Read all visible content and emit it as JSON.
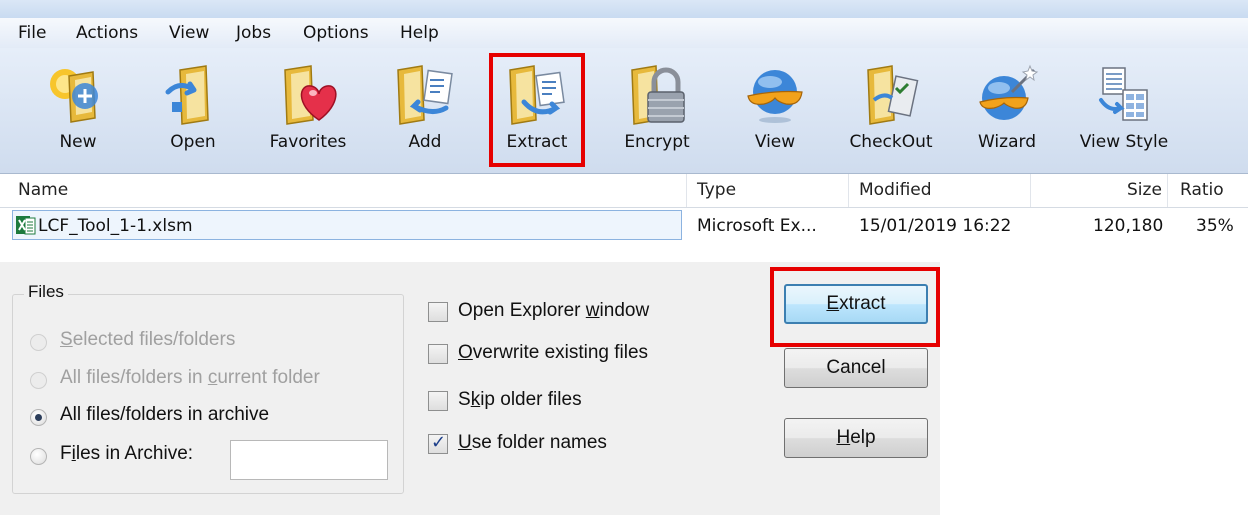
{
  "menu": [
    "File",
    "Actions",
    "View",
    "Jobs",
    "Options",
    "Help"
  ],
  "toolbar": [
    {
      "label": "New",
      "icon": "new-icon"
    },
    {
      "label": "Open",
      "icon": "open-icon"
    },
    {
      "label": "Favorites",
      "icon": "favorites-icon"
    },
    {
      "label": "Add",
      "icon": "add-icon"
    },
    {
      "label": "Extract",
      "icon": "extract-icon"
    },
    {
      "label": "Encrypt",
      "icon": "encrypt-icon"
    },
    {
      "label": "View",
      "icon": "view-icon"
    },
    {
      "label": "CheckOut",
      "icon": "checkout-icon"
    },
    {
      "label": "Wizard",
      "icon": "wizard-icon"
    },
    {
      "label": "View Style",
      "icon": "view-style-icon"
    }
  ],
  "columns": {
    "name": "Name",
    "type": "Type",
    "modified": "Modified",
    "size": "Size",
    "ratio": "Ratio"
  },
  "file": {
    "name": "LCF_Tool_1-1.xlsm",
    "type": "Microsoft Ex...",
    "modified": "15/01/2019 16:22",
    "size": "120,180",
    "ratio": "35%"
  },
  "dialog": {
    "files_group": "Files",
    "radio": [
      {
        "pre": "",
        "ul": "S",
        "post": "elected files/folders",
        "state": "disabled"
      },
      {
        "pre": "All files/folders in ",
        "ul": "c",
        "post": "urrent folder",
        "state": "disabled"
      },
      {
        "pre": "All files/folders in archive",
        "ul": "",
        "post": "",
        "state": "selected"
      },
      {
        "pre": "F",
        "ul": "i",
        "post": "les in Archive:",
        "state": "unselected"
      }
    ],
    "files_in_archive_value": "",
    "checkboxes": [
      {
        "pre": "Open Explorer ",
        "ul": "w",
        "post": "indow",
        "checked": false
      },
      {
        "pre": "",
        "ul": "O",
        "post": "verwrite existing files",
        "checked": false
      },
      {
        "pre": "S",
        "ul": "k",
        "post": "ip older files",
        "checked": false
      },
      {
        "pre": "",
        "ul": "U",
        "post": "se folder names",
        "checked": true
      }
    ],
    "buttons": {
      "extract": {
        "pre": "",
        "ul": "E",
        "post": "xtract"
      },
      "cancel": "Cancel",
      "help": {
        "pre": "",
        "ul": "H",
        "post": "elp"
      }
    }
  },
  "colors": {
    "highlight": "#e60000",
    "toolbar_bg": "#d9e4f3"
  }
}
